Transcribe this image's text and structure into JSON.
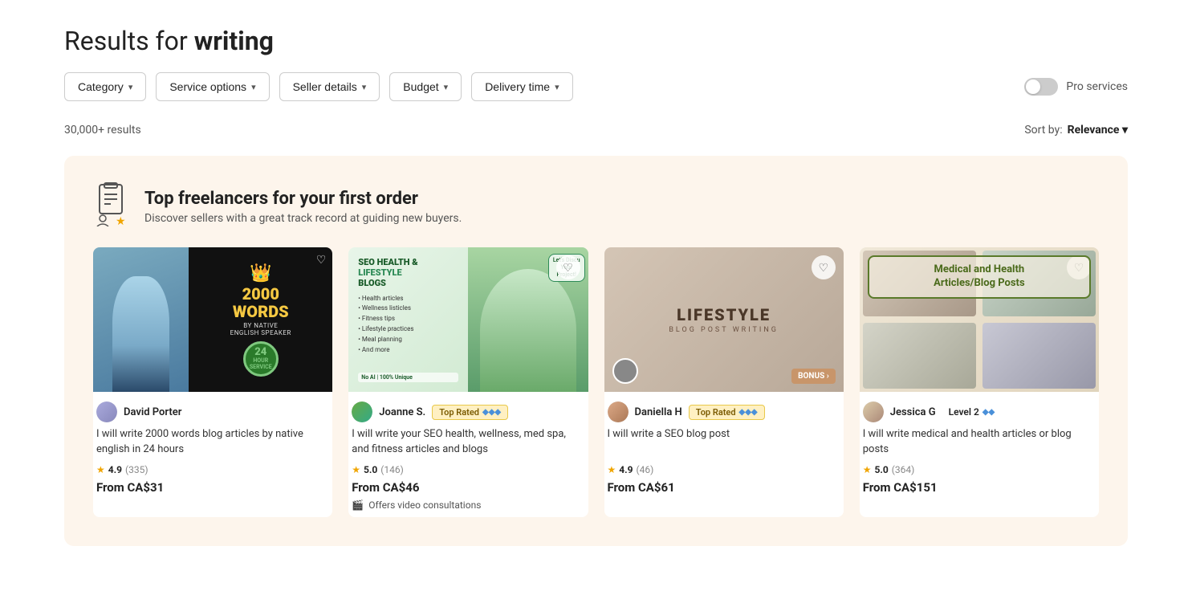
{
  "page": {
    "results_title_prefix": "Results for ",
    "results_title_bold": "writing",
    "results_count": "30,000+ results",
    "sort_label": "Sort by:",
    "sort_value": "Relevance"
  },
  "filters": [
    {
      "id": "category",
      "label": "Category"
    },
    {
      "id": "service-options",
      "label": "Service options"
    },
    {
      "id": "seller-details",
      "label": "Seller details"
    },
    {
      "id": "budget",
      "label": "Budget"
    },
    {
      "id": "delivery-time",
      "label": "Delivery time"
    }
  ],
  "pro_services": {
    "label": "Pro services",
    "enabled": false
  },
  "banner": {
    "title": "Top freelancers for your first order",
    "subtitle": "Discover sellers with a great track record at guiding new buyers."
  },
  "cards": [
    {
      "id": "card-1",
      "seller_name": "David Porter",
      "badge": null,
      "title": "I will write 2000 words blog articles by native english in 24 hours",
      "rating": "4.9",
      "rating_count": "(335)",
      "price": "From CA$31",
      "offers_video": false,
      "heart": "♡"
    },
    {
      "id": "card-2",
      "seller_name": "Joanne S.",
      "badge": "Top Rated",
      "title": "I will write your SEO health, wellness, med spa, and fitness articles and blogs",
      "rating": "5.0",
      "rating_count": "(146)",
      "price": "From CA$46",
      "offers_video": true,
      "video_label": "Offers video consultations",
      "heart": "♡"
    },
    {
      "id": "card-3",
      "seller_name": "Daniella H",
      "badge": "Top Rated",
      "title": "I will write a SEO blog post",
      "rating": "4.9",
      "rating_count": "(46)",
      "price": "From CA$61",
      "offers_video": false,
      "heart": "♡"
    },
    {
      "id": "card-4",
      "seller_name": "Jessica G",
      "badge": "Level 2",
      "title": "I will write medical and health articles or blog posts",
      "rating": "5.0",
      "rating_count": "(364)",
      "price": "From CA$151",
      "offers_video": false,
      "heart": "♡"
    }
  ]
}
